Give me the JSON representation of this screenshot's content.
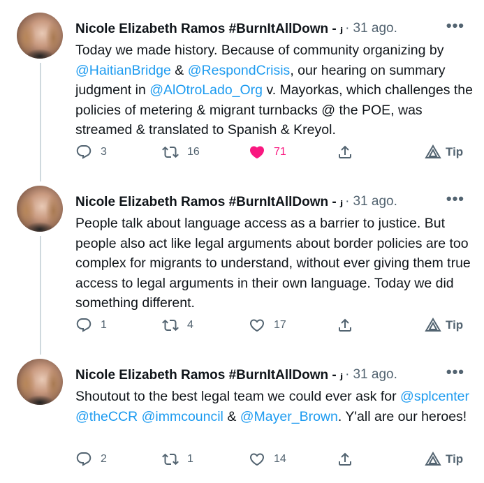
{
  "tweets": [
    {
      "author_name": "Nicole Elizabeth Ramos #BurnItAllDown - ⱼ",
      "separator": "·",
      "time": "31 ago.",
      "more": "•••",
      "text_parts": [
        {
          "t": "Today we made history. Because of community organizing by ",
          "m": false
        },
        {
          "t": "@HaitianBridge",
          "m": true
        },
        {
          "t": " & ",
          "m": false
        },
        {
          "t": " @RespondCrisis",
          "m": true
        },
        {
          "t": ", our hearing on summary judgment in ",
          "m": false
        },
        {
          "t": "@AlOtroLado_Org",
          "m": true
        },
        {
          "t": " v. Mayorkas, which challenges the policies of metering & migrant turnbacks @ the POE, was streamed & translated to Spanish & Kreyol.",
          "m": false
        }
      ],
      "replies": "3",
      "retweets": "16",
      "likes": "71",
      "liked": true,
      "tip": "Tip"
    },
    {
      "author_name": "Nicole Elizabeth Ramos #BurnItAllDown - ⱼ",
      "separator": "·",
      "time": "31 ago.",
      "more": "•••",
      "text_parts": [
        {
          "t": "People talk about language access as a barrier to justice. But people also act like legal arguments about border policies are too complex for migrants to understand, without ever giving them true access to legal arguments in their own language. Today we did something different.",
          "m": false
        }
      ],
      "replies": "1",
      "retweets": "4",
      "likes": "17",
      "liked": false,
      "tip": "Tip"
    },
    {
      "author_name": "Nicole Elizabeth Ramos #BurnItAllDown - ⱼ",
      "separator": "·",
      "time": "31 ago.",
      "more": "•••",
      "text_parts": [
        {
          "t": "Shoutout to the best legal team we could ever ask for ",
          "m": false
        },
        {
          "t": "@splcenter",
          "m": true
        },
        {
          "t": " ",
          "m": false
        },
        {
          "t": "@theCCR",
          "m": true
        },
        {
          "t": " ",
          "m": false
        },
        {
          "t": "@immcouncil",
          "m": true
        },
        {
          "t": "  & ",
          "m": false
        },
        {
          "t": "@Mayer_Brown",
          "m": true
        },
        {
          "t": ". Y'all are our heroes!",
          "m": false
        }
      ],
      "replies": "2",
      "retweets": "1",
      "likes": "14",
      "liked": false,
      "tip": "Tip"
    }
  ],
  "icons": {
    "reply": "reply-icon",
    "retweet": "retweet-icon",
    "like": "heart-icon",
    "share": "share-icon",
    "tip": "tip-icon"
  },
  "colors": {
    "mention": "#1d9bf0",
    "like_active": "#f91880",
    "secondary_text": "#536471",
    "thread_line": "#cfd9de"
  }
}
